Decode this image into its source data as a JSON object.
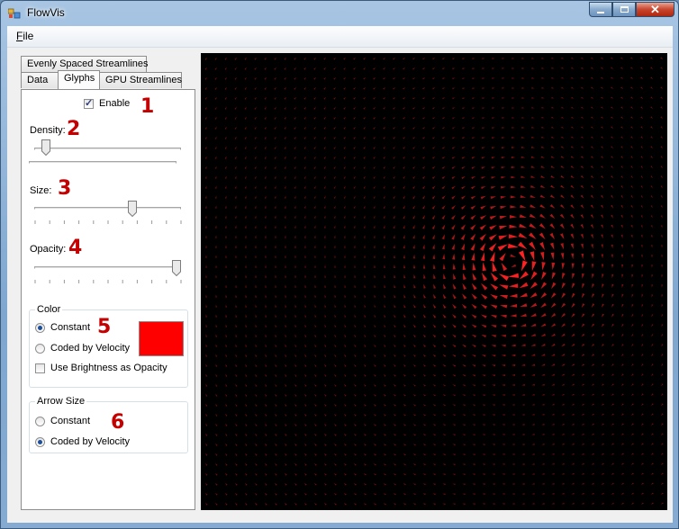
{
  "window": {
    "title": "FlowVis",
    "icon": "app-window-icon"
  },
  "menu": {
    "file_label": "File"
  },
  "tabs": {
    "row_back": [
      "Evenly Spaced Streamlines"
    ],
    "row_front": [
      "Data",
      "Glyphs",
      "GPU Streamlines"
    ],
    "active": "Glyphs"
  },
  "glyphs": {
    "enable_label": "Enable",
    "enable_checked": true,
    "density_label": "Density:",
    "density_fraction": 0.05,
    "size_label": "Size:",
    "size_fraction": 0.68,
    "opacity_label": "Opacity:",
    "opacity_fraction": 1.0,
    "color_group_title": "Color",
    "color_constant_label": "Constant",
    "color_velocity_label": "Coded by Velocity",
    "brightness_opacity_label": "Use Brightness as Opacity",
    "color_mode": "constant",
    "swatch_color": "#ff0000",
    "arrow_group_title": "Arrow Size",
    "arrow_constant_label": "Constant",
    "arrow_velocity_label": "Coded by Velocity",
    "arrow_mode": "velocity"
  },
  "annotations": [
    "1",
    "2",
    "3",
    "4",
    "5",
    "6"
  ],
  "visualization": {
    "background": "#000000",
    "glyph_color": "#ff2222"
  }
}
